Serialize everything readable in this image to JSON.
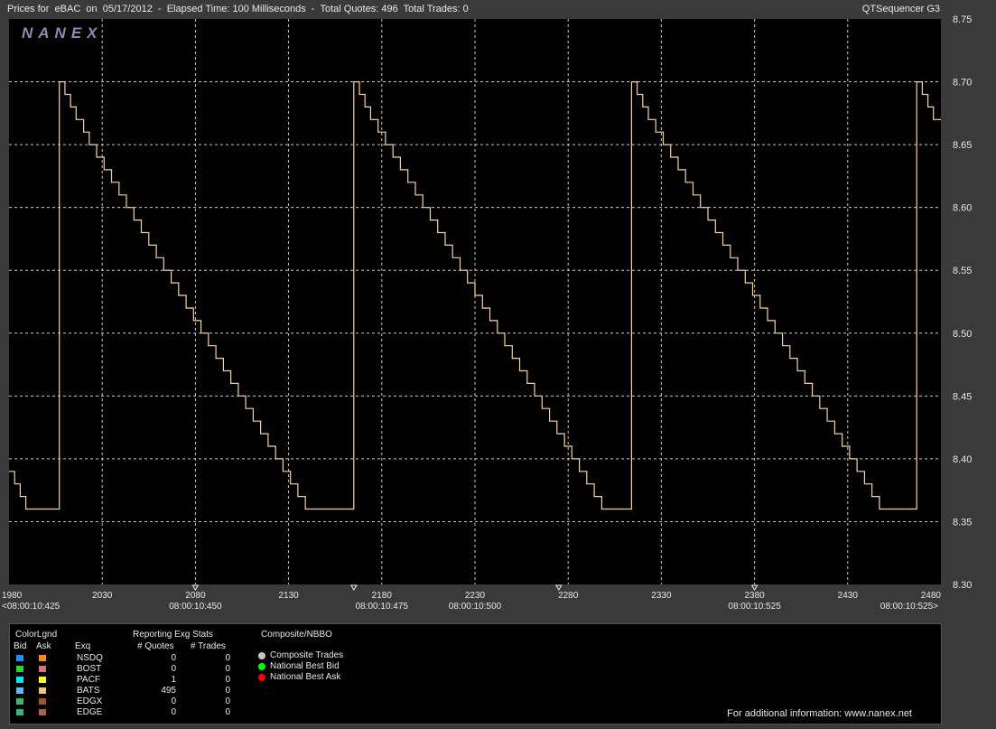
{
  "window": {
    "title": "Prices for  eBAC  on  05/17/2012  -  Elapsed Time: 100 Milliseconds  -  Total Quotes: 496  Total Trades: 0",
    "app_name": "QTSequencer G3",
    "logo": "NANEX"
  },
  "colors": {
    "background": "#000000",
    "grid": "#c8c8c8",
    "price_line": "#f5d2a6"
  },
  "chart_data": {
    "type": "line",
    "title": "",
    "xlabel": "",
    "ylabel": "",
    "xlim": [
      1980,
      2480
    ],
    "ylim": [
      8.3,
      8.75
    ],
    "grid": true,
    "x_ticks": [
      "1980",
      "2030",
      "2080",
      "2130",
      "2180",
      "2230",
      "2280",
      "2330",
      "2380",
      "2430",
      "2480"
    ],
    "y_ticks": [
      "8.30",
      "8.35",
      "8.40",
      "8.45",
      "8.50",
      "8.55",
      "8.60",
      "8.65",
      "8.70",
      "8.75"
    ],
    "time_labels": [
      {
        "seq": 1980,
        "text": "<08:00:10:425"
      },
      {
        "seq": 2080,
        "text": "08:00:10:450"
      },
      {
        "seq": 2180,
        "text": "08:00:10:475"
      },
      {
        "seq": 2230,
        "text": "08:00:10:500"
      },
      {
        "seq": 2380,
        "text": "08:00:10:525"
      },
      {
        "seq": 2480,
        "text": "08:00:10:525>"
      }
    ],
    "time_markers": [
      2080,
      2165,
      2275,
      2380
    ],
    "series": [
      {
        "cycles": [
          {
            "up_seq": 2007,
            "down_start": 2008,
            "down_end": 2170,
            "low_end": 2173
          },
          {
            "up_seq": 2174,
            "down_start": 2175,
            "down_end": 2316,
            "low_end": 2319
          },
          {
            "up_seq": 2320,
            "down_start": 2321,
            "down_end": 2465,
            "low_end": 2468
          },
          {
            "up_seq": 2469,
            "down_start": 2470,
            "down_end": 2480,
            "low_end": 2480
          }
        ],
        "points": [
          [
            1980,
            8.39
          ],
          [
            1983,
            8.38
          ],
          [
            1986,
            8.37
          ],
          [
            1989,
            8.36
          ],
          [
            2006,
            8.36
          ],
          [
            2007,
            8.7
          ],
          [
            2010,
            8.69
          ],
          [
            2013,
            8.68
          ],
          [
            2016,
            8.67
          ],
          [
            2020,
            8.66
          ],
          [
            2023,
            8.65
          ],
          [
            2027,
            8.64
          ],
          [
            2031,
            8.63
          ],
          [
            2035,
            8.62
          ],
          [
            2039,
            8.61
          ],
          [
            2043,
            8.6
          ],
          [
            2047,
            8.59
          ],
          [
            2051,
            8.58
          ],
          [
            2055,
            8.57
          ],
          [
            2059,
            8.56
          ],
          [
            2063,
            8.55
          ],
          [
            2067,
            8.54
          ],
          [
            2071,
            8.53
          ],
          [
            2075,
            8.52
          ],
          [
            2079,
            8.51
          ],
          [
            2083,
            8.5
          ],
          [
            2087,
            8.49
          ],
          [
            2091,
            8.48
          ],
          [
            2095,
            8.47
          ],
          [
            2099,
            8.46
          ],
          [
            2103,
            8.45
          ],
          [
            2107,
            8.44
          ],
          [
            2111,
            8.43
          ],
          [
            2115,
            8.42
          ],
          [
            2119,
            8.41
          ],
          [
            2123,
            8.4
          ],
          [
            2127,
            8.39
          ],
          [
            2131,
            8.38
          ],
          [
            2135,
            8.37
          ],
          [
            2139,
            8.36
          ],
          [
            2164,
            8.36
          ],
          [
            2165,
            8.7
          ],
          [
            2168,
            8.69
          ],
          [
            2171,
            8.68
          ],
          [
            2174,
            8.67
          ],
          [
            2178,
            8.66
          ],
          [
            2182,
            8.65
          ],
          [
            2186,
            8.64
          ],
          [
            2190,
            8.63
          ],
          [
            2194,
            8.62
          ],
          [
            2198,
            8.61
          ],
          [
            2202,
            8.6
          ],
          [
            2206,
            8.59
          ],
          [
            2210,
            8.58
          ],
          [
            2214,
            8.57
          ],
          [
            2218,
            8.56
          ],
          [
            2222,
            8.55
          ],
          [
            2226,
            8.54
          ],
          [
            2230,
            8.53
          ],
          [
            2234,
            8.52
          ],
          [
            2238,
            8.51
          ],
          [
            2242,
            8.5
          ],
          [
            2246,
            8.49
          ],
          [
            2250,
            8.48
          ],
          [
            2254,
            8.47
          ],
          [
            2258,
            8.46
          ],
          [
            2262,
            8.45
          ],
          [
            2266,
            8.44
          ],
          [
            2270,
            8.43
          ],
          [
            2274,
            8.42
          ],
          [
            2278,
            8.41
          ],
          [
            2282,
            8.4
          ],
          [
            2286,
            8.39
          ],
          [
            2290,
            8.38
          ],
          [
            2294,
            8.37
          ],
          [
            2298,
            8.36
          ],
          [
            2313,
            8.36
          ],
          [
            2314,
            8.7
          ],
          [
            2317,
            8.69
          ],
          [
            2320,
            8.68
          ],
          [
            2323,
            8.67
          ],
          [
            2327,
            8.66
          ],
          [
            2331,
            8.65
          ],
          [
            2335,
            8.64
          ],
          [
            2339,
            8.63
          ],
          [
            2343,
            8.62
          ],
          [
            2347,
            8.61
          ],
          [
            2351,
            8.6
          ],
          [
            2355,
            8.59
          ],
          [
            2359,
            8.58
          ],
          [
            2363,
            8.57
          ],
          [
            2367,
            8.56
          ],
          [
            2371,
            8.55
          ],
          [
            2375,
            8.54
          ],
          [
            2379,
            8.53
          ],
          [
            2383,
            8.52
          ],
          [
            2387,
            8.51
          ],
          [
            2391,
            8.5
          ],
          [
            2395,
            8.49
          ],
          [
            2399,
            8.48
          ],
          [
            2403,
            8.47
          ],
          [
            2407,
            8.46
          ],
          [
            2411,
            8.45
          ],
          [
            2415,
            8.44
          ],
          [
            2419,
            8.43
          ],
          [
            2423,
            8.42
          ],
          [
            2427,
            8.41
          ],
          [
            2431,
            8.4
          ],
          [
            2435,
            8.39
          ],
          [
            2439,
            8.38
          ],
          [
            2443,
            8.37
          ],
          [
            2447,
            8.36
          ],
          [
            2466,
            8.36
          ],
          [
            2467,
            8.7
          ],
          [
            2470,
            8.69
          ],
          [
            2473,
            8.68
          ],
          [
            2476,
            8.67
          ],
          [
            2480,
            8.67
          ]
        ]
      }
    ]
  },
  "legend": {
    "headers": {
      "color_legend": "ColorLgnd",
      "bid": "Bid",
      "ask": "Ask",
      "exchange": "Exq",
      "reporting": "Reporting Exg Stats",
      "quotes": "# Quotes",
      "trades": "# Trades",
      "composite": "Composite/NBBO"
    },
    "rows": [
      {
        "exchange": "NSDQ",
        "bid_color": "#1e90ff",
        "ask_color": "#ff8c00",
        "quotes": "0",
        "trades": "0"
      },
      {
        "exchange": "BOST",
        "bid_color": "#32cd32",
        "ask_color": "#d27878",
        "quotes": "0",
        "trades": "0"
      },
      {
        "exchange": "PACF",
        "bid_color": "#00e5ee",
        "ask_color": "#ffff00",
        "quotes": "1",
        "trades": "0"
      },
      {
        "exchange": "BATS",
        "bid_color": "#63b8ff",
        "ask_color": "#ffc36b",
        "quotes": "495",
        "trades": "0"
      },
      {
        "exchange": "EDGX",
        "bid_color": "#3cb371",
        "ask_color": "#a0522d",
        "quotes": "0",
        "trades": "0"
      },
      {
        "exchange": "EDGE",
        "bid_color": "#3cb371",
        "ask_color": "#b0604a",
        "quotes": "0",
        "trades": "0"
      }
    ],
    "composite_items": [
      {
        "label": "Composite Trades",
        "color": "#c8c8c8"
      },
      {
        "label": "National Best Bid",
        "color": "#00ff00"
      },
      {
        "label": "National Best Ask",
        "color": "#ff0000"
      }
    ],
    "footer": "For additional information: www.nanex.net"
  }
}
